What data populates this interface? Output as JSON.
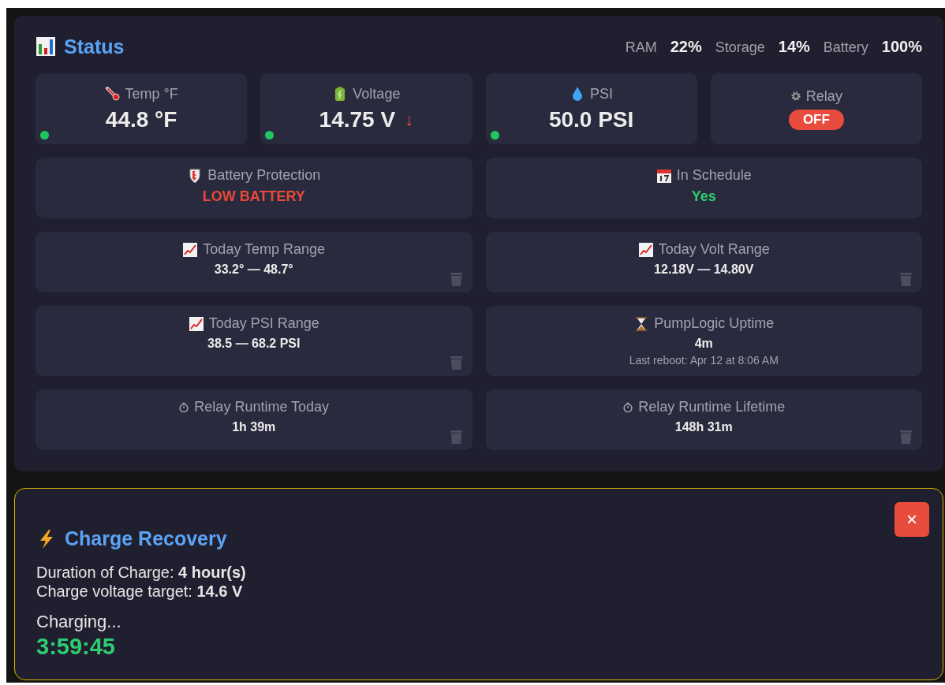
{
  "header": {
    "title": "Status",
    "stats": [
      {
        "label": "RAM",
        "value": "22%"
      },
      {
        "label": "Storage",
        "value": "14%"
      },
      {
        "label": "Battery",
        "value": "100%"
      }
    ]
  },
  "sensors": [
    {
      "kind": "reading",
      "label": "Temp °F",
      "value": "44.8 °F",
      "color": "#22c55e"
    },
    {
      "kind": "reading",
      "label": "Voltage",
      "value": "14.75 V",
      "trend": "↓",
      "color": "#22c55e"
    },
    {
      "kind": "reading",
      "label": "PSI",
      "value": "50.0 PSI",
      "color": "#22c55e"
    },
    {
      "kind": "toggle",
      "label": "Relay",
      "on": false,
      "state": "OFF"
    }
  ],
  "cards": [
    {
      "label": "Battery Protection",
      "value": "LOW BATTERY",
      "kind": "alert",
      "resettable": false
    },
    {
      "label": "In Schedule",
      "value": "Yes",
      "kind": "ok",
      "resettable": false
    },
    {
      "label": "Today Temp Range",
      "value": "33.2° — 48.7°",
      "kind": "plain",
      "resettable": true
    },
    {
      "label": "Today Volt Range",
      "value": "12.18V — 14.80V",
      "kind": "plain",
      "resettable": true
    },
    {
      "label": "Today PSI Range",
      "value": "38.5 — 68.2 PSI",
      "kind": "plain",
      "resettable": true
    },
    {
      "label": "PumpLogic Uptime",
      "value": "4m",
      "note": "Last reboot: Apr 12 at 8:06 AM",
      "kind": "plain",
      "resettable": false
    },
    {
      "label": "Relay Runtime Today",
      "value": "1h 39m",
      "kind": "plain",
      "resettable": true
    },
    {
      "label": "Relay Runtime Lifetime",
      "value": "148h 31m",
      "kind": "plain",
      "resettable": true
    }
  ],
  "recovery": {
    "title": "Charge Recovery",
    "close": "×",
    "lines": [
      "Duration of Charge: **4 hour(s)**",
      "Charge voltage target: **14.6 V**"
    ],
    "status": "Charging...",
    "countdown": "3:59:45"
  }
}
